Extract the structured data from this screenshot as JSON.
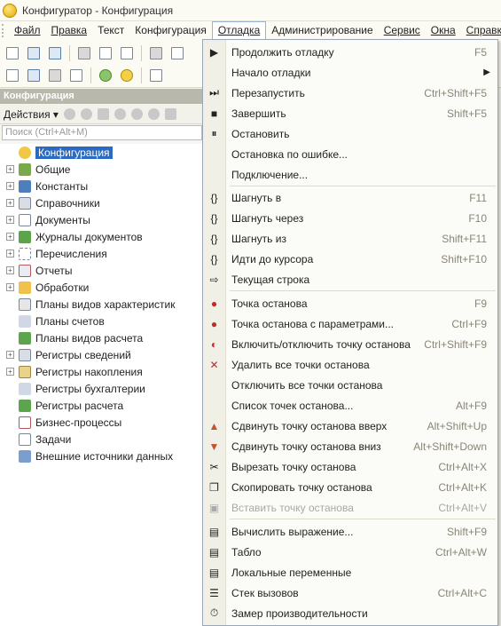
{
  "window": {
    "title": "Конфигуратор - Конфигурация"
  },
  "menubar": {
    "items": [
      {
        "label": "Файл"
      },
      {
        "label": "Правка"
      },
      {
        "label": "Текст"
      },
      {
        "label": "Конфигурация"
      },
      {
        "label": "Отладка"
      },
      {
        "label": "Администрирование"
      },
      {
        "label": "Сервис"
      },
      {
        "label": "Окна"
      },
      {
        "label": "Справка"
      }
    ]
  },
  "panel": {
    "title": "Конфигурация",
    "actions_label": "Действия",
    "search_placeholder": "Поиск (Ctrl+Alt+M)"
  },
  "tree": {
    "items": [
      {
        "label": "Конфигурация",
        "icon": "configuration-icon"
      },
      {
        "label": "Общие",
        "icon": "common-icon"
      },
      {
        "label": "Константы",
        "icon": "constants-icon"
      },
      {
        "label": "Справочники",
        "icon": "catalogs-icon"
      },
      {
        "label": "Документы",
        "icon": "documents-icon"
      },
      {
        "label": "Журналы документов",
        "icon": "document-journals-icon"
      },
      {
        "label": "Перечисления",
        "icon": "enums-icon"
      },
      {
        "label": "Отчеты",
        "icon": "reports-icon"
      },
      {
        "label": "Обработки",
        "icon": "data-processors-icon"
      },
      {
        "label": "Планы видов характеристик",
        "icon": "characteristic-types-icon"
      },
      {
        "label": "Планы счетов",
        "icon": "chart-of-accounts-icon"
      },
      {
        "label": "Планы видов расчета",
        "icon": "calculation-types-icon"
      },
      {
        "label": "Регистры сведений",
        "icon": "information-registers-icon"
      },
      {
        "label": "Регистры накопления",
        "icon": "accumulation-registers-icon"
      },
      {
        "label": "Регистры бухгалтерии",
        "icon": "accounting-registers-icon"
      },
      {
        "label": "Регистры расчета",
        "icon": "calculation-registers-icon"
      },
      {
        "label": "Бизнес-процессы",
        "icon": "business-processes-icon"
      },
      {
        "label": "Задачи",
        "icon": "tasks-icon"
      },
      {
        "label": "Внешние источники данных",
        "icon": "external-data-sources-icon"
      }
    ]
  },
  "debug_menu": {
    "items": [
      {
        "label": "Продолжить отладку",
        "shortcut": "F5",
        "icon": "continue-debug-icon"
      },
      {
        "label": "Начало отладки",
        "shortcut": "",
        "icon": "",
        "submenu": true
      },
      {
        "label": "Перезапустить",
        "shortcut": "Ctrl+Shift+F5",
        "icon": "restart-icon"
      },
      {
        "label": "Завершить",
        "shortcut": "Shift+F5",
        "icon": "stop-icon"
      },
      {
        "label": "Остановить",
        "shortcut": "",
        "icon": "pause-icon"
      },
      {
        "label": "Остановка по ошибке...",
        "shortcut": "",
        "icon": ""
      },
      {
        "label": "Подключение...",
        "shortcut": "",
        "icon": ""
      },
      {
        "label": "Шагнуть в",
        "shortcut": "F11",
        "icon": "step-into-icon"
      },
      {
        "label": "Шагнуть через",
        "shortcut": "F10",
        "icon": "step-over-icon"
      },
      {
        "label": "Шагнуть из",
        "shortcut": "Shift+F11",
        "icon": "step-out-icon"
      },
      {
        "label": "Идти до курсора",
        "shortcut": "Shift+F10",
        "icon": "run-to-cursor-icon"
      },
      {
        "label": "Текущая строка",
        "shortcut": "",
        "icon": "current-line-icon"
      },
      {
        "label": "Точка останова",
        "shortcut": "F9",
        "icon": "breakpoint-icon"
      },
      {
        "label": "Точка останова с параметрами...",
        "shortcut": "Ctrl+F9",
        "icon": "conditional-breakpoint-icon"
      },
      {
        "label": "Включить/отключить точку останова",
        "shortcut": "Ctrl+Shift+F9",
        "icon": "toggle-breakpoint-icon"
      },
      {
        "label": "Удалить все точки останова",
        "shortcut": "",
        "icon": "delete-breakpoints-icon"
      },
      {
        "label": "Отключить все точки останова",
        "shortcut": "",
        "icon": ""
      },
      {
        "label": "Список точек останова...",
        "shortcut": "Alt+F9",
        "icon": ""
      },
      {
        "label": "Сдвинуть точку останова вверх",
        "shortcut": "Alt+Shift+Up",
        "icon": "breakpoint-up-icon"
      },
      {
        "label": "Сдвинуть точку останова вниз",
        "shortcut": "Alt+Shift+Down",
        "icon": "breakpoint-down-icon"
      },
      {
        "label": "Вырезать точку останова",
        "shortcut": "Ctrl+Alt+X",
        "icon": "cut-breakpoint-icon"
      },
      {
        "label": "Скопировать точку останова",
        "shortcut": "Ctrl+Alt+K",
        "icon": "copy-breakpoint-icon"
      },
      {
        "label": "Вставить точку останова",
        "shortcut": "Ctrl+Alt+V",
        "icon": "paste-breakpoint-icon",
        "disabled": true
      },
      {
        "label": "Вычислить выражение...",
        "shortcut": "Shift+F9",
        "icon": "evaluate-icon"
      },
      {
        "label": "Табло",
        "shortcut": "Ctrl+Alt+W",
        "icon": "watch-icon"
      },
      {
        "label": "Локальные переменные",
        "shortcut": "",
        "icon": "locals-icon"
      },
      {
        "label": "Стек вызовов",
        "shortcut": "Ctrl+Alt+C",
        "icon": "call-stack-icon"
      },
      {
        "label": "Замер производительности",
        "shortcut": "",
        "icon": "performance-icon"
      }
    ]
  },
  "colors": {
    "selection": "#2c6ac1",
    "panel_header": "#b9b8ac",
    "menu_background": "#fbfbf7"
  }
}
